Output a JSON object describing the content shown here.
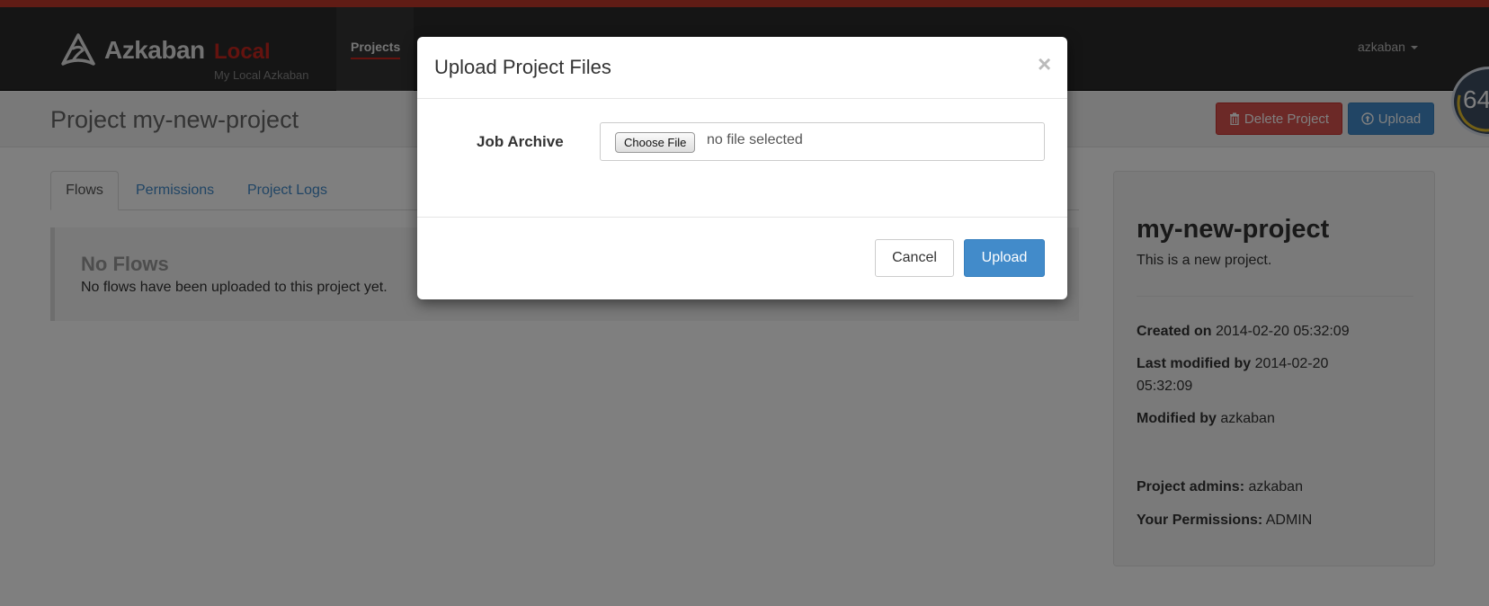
{
  "brand": {
    "name": "Azkaban",
    "env": "Local",
    "subtitle": "My Local Azkaban",
    "logo_icon": "azkaban-logo-icon"
  },
  "nav": {
    "projects_label": "Projects",
    "user_label": "azkaban"
  },
  "project_header": {
    "title": "Project my-new-project",
    "delete_label": "Delete Project",
    "upload_label": "Upload",
    "timer_value": "64"
  },
  "tabs": [
    {
      "label": "Flows",
      "active": true
    },
    {
      "label": "Permissions",
      "active": false
    },
    {
      "label": "Project Logs",
      "active": false
    }
  ],
  "flows": {
    "title": "No Flows",
    "message": "No flows have been uploaded to this project yet."
  },
  "panel": {
    "project_name": "my-new-project",
    "description": "This is a new project.",
    "created_on_label": "Created on",
    "created_on_value": "2014-02-20 05:32:09",
    "last_modified_label": "Last modified by",
    "last_modified_value": "2014-02-20 05:32:09",
    "modified_by_label": "Modified by",
    "modified_by_value": "azkaban",
    "admins_label": "Project admins:",
    "admins_value": "azkaban",
    "permissions_label": "Your Permissions:",
    "permissions_value": "ADMIN"
  },
  "modal": {
    "title": "Upload Project Files",
    "close_glyph": "×",
    "field_label": "Job Archive",
    "choose_file_label": "Choose File",
    "file_status": "no file selected",
    "cancel_label": "Cancel",
    "upload_label": "Upload"
  },
  "colors": {
    "accent_red": "#c8261f",
    "primary_blue": "#428bca",
    "danger_red": "#d9534f",
    "navbar_bg": "#2b2b2b"
  }
}
